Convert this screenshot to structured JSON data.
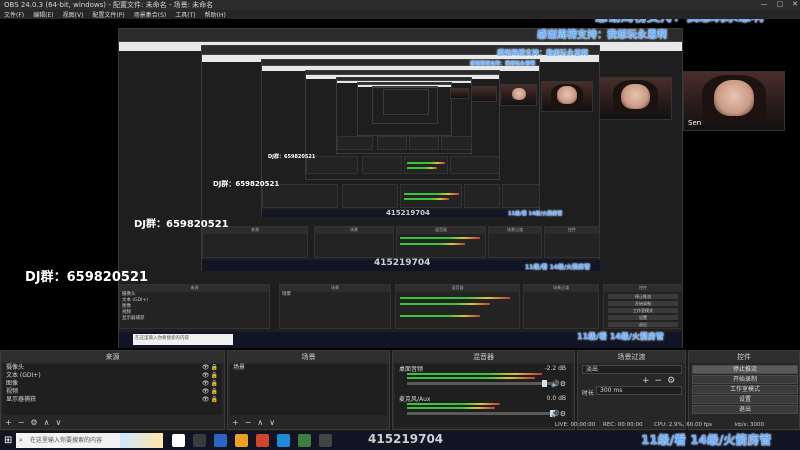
{
  "window": {
    "title": "OBS 24.0.3 (64-bit, windows) - 配置文件: 未命名 - 场景: 未命名",
    "controls": [
      "—",
      "□",
      "✕"
    ]
  },
  "menu": [
    "文件(F)",
    "编辑(E)",
    "视图(V)",
    "配置文件(P)",
    "场景集合(S)",
    "工具(T)",
    "帮助(H)"
  ],
  "preview": {
    "banner_text": "感谢周榜支持：我想玩永恩啊",
    "qq_group": "DJ群：659820521",
    "qq_number": "415219704",
    "gift_text": "11级/看 14级/火箭房管",
    "webcam_label": "Sen",
    "inner_search_placeholder": "在这里输入你要搜索的内容"
  },
  "docks": {
    "sources": {
      "title": "来源",
      "items": [
        "摄像头",
        "文本 (GDI+)",
        "图像",
        "视频",
        "显示器捕获"
      ],
      "tools": [
        "+",
        "−",
        "⚙",
        "∧",
        "∨"
      ]
    },
    "scenes": {
      "title": "场景",
      "items": [
        "场景"
      ],
      "tools": [
        "+",
        "−",
        "∧",
        "∨"
      ]
    },
    "mixer": {
      "title": "混音器",
      "channels": [
        {
          "name": "桌面音频",
          "db": "-2.2 dB",
          "level_pct": 90,
          "volume_pct": 92
        },
        {
          "name": "麦克风/Aux",
          "db": "0.0 dB",
          "level_pct": 62,
          "volume_pct": 97
        }
      ]
    },
    "transitions": {
      "title": "场景过渡",
      "type": "淡出",
      "duration_label": "时长",
      "duration_value": "300 ms",
      "tools": [
        "+",
        "−",
        "⚙"
      ]
    },
    "controls": {
      "title": "控件",
      "buttons": [
        "停止推流",
        "开始录制",
        "工作室模式",
        "设置",
        "退出"
      ]
    }
  },
  "status": {
    "live": "LIVE: 00:00:00",
    "rec": "REC: 00:00:00",
    "cpu": "CPU: 2.9%, 60.00 fps",
    "kbps": "kb/s: 3000"
  },
  "taskbar": {
    "search_placeholder": "在这里输入你要搜索的内容",
    "app_colors": [
      "#ffffff",
      "#3b3b3b",
      "#2a66c2",
      "#f0a020",
      "#d2452a",
      "#1f8ad8",
      "#3d7d3d",
      "#444444"
    ]
  }
}
